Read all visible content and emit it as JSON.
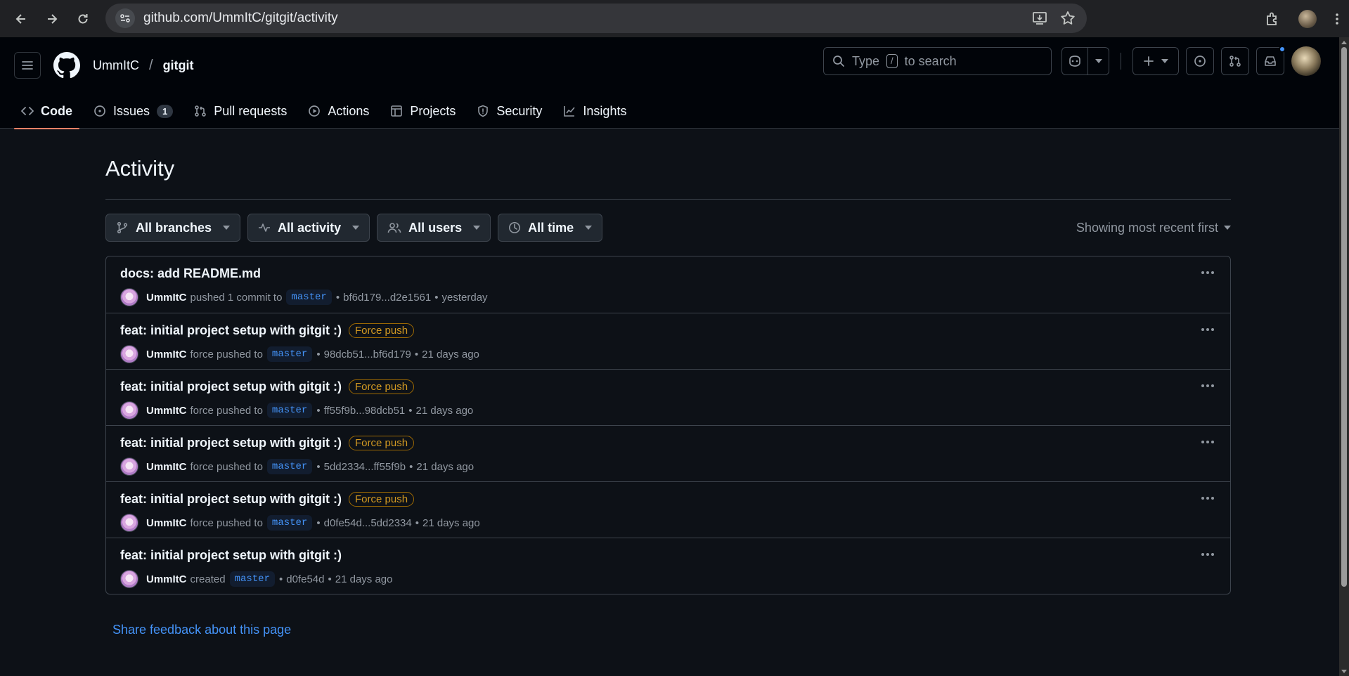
{
  "browser": {
    "url_host": "github.com",
    "url_path": "/UmmItC/gitgit/activity"
  },
  "header": {
    "owner": "UmmItC",
    "separator": "/",
    "repo": "gitgit",
    "search_prefix": "Type",
    "search_key": "/",
    "search_suffix": "to search"
  },
  "tabs": [
    {
      "label": "Code",
      "icon": "code-icon",
      "active": true
    },
    {
      "label": "Issues",
      "icon": "issue-icon",
      "count": "1"
    },
    {
      "label": "Pull requests",
      "icon": "pull-request-icon"
    },
    {
      "label": "Actions",
      "icon": "play-icon"
    },
    {
      "label": "Projects",
      "icon": "table-icon"
    },
    {
      "label": "Security",
      "icon": "shield-icon"
    },
    {
      "label": "Insights",
      "icon": "graph-icon"
    }
  ],
  "page": {
    "title": "Activity",
    "sort_label": "Showing most recent first",
    "feedback_link": "Share feedback about this page"
  },
  "filters": {
    "branches": "All branches",
    "activity": "All activity",
    "users": "All users",
    "time": "All time"
  },
  "activities": [
    {
      "title": "docs: add README.md",
      "force_label": "",
      "user": "UmmItC",
      "action": "pushed 1 commit to",
      "branch": "master",
      "range": "bf6d179...d2e1561",
      "time": "yesterday"
    },
    {
      "title": "feat: initial project setup with gitgit :)",
      "force_label": "Force push",
      "user": "UmmItC",
      "action": "force pushed to",
      "branch": "master",
      "range": "98dcb51...bf6d179",
      "time": "21 days ago"
    },
    {
      "title": "feat: initial project setup with gitgit :)",
      "force_label": "Force push",
      "user": "UmmItC",
      "action": "force pushed to",
      "branch": "master",
      "range": "ff55f9b...98dcb51",
      "time": "21 days ago"
    },
    {
      "title": "feat: initial project setup with gitgit :)",
      "force_label": "Force push",
      "user": "UmmItC",
      "action": "force pushed to",
      "branch": "master",
      "range": "5dd2334...ff55f9b",
      "time": "21 days ago"
    },
    {
      "title": "feat: initial project setup with gitgit :)",
      "force_label": "Force push",
      "user": "UmmItC",
      "action": "force pushed to",
      "branch": "master",
      "range": "d0fe54d...5dd2334",
      "time": "21 days ago"
    },
    {
      "title": "feat: initial project setup with gitgit :)",
      "force_label": "",
      "user": "UmmItC",
      "action": "created",
      "branch": "master",
      "range": "d0fe54d",
      "time": "21 days ago"
    }
  ],
  "meta_separator": "•",
  "colors": {
    "background": "#0d1117",
    "header_bg": "#010409",
    "accent_tab": "#f78166",
    "link": "#4493f8",
    "force_push": "#d29922"
  }
}
